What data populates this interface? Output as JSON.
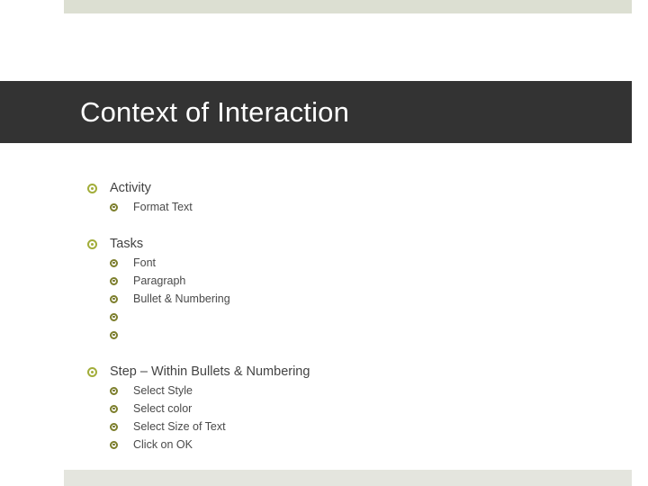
{
  "slide": {
    "title": "Context of Interaction",
    "colors": {
      "title_bar": "#333333",
      "title_text": "#ffffff",
      "band_top": "#dcdfd2",
      "band_bottom": "#e4e5de",
      "bullet_level1": "#a2ad3a",
      "bullet_level2": "#7d7f2c",
      "body_text": "#434343",
      "background": "#ffffff"
    },
    "bullet_icon": "bullseye-bullet-icon",
    "groups": [
      {
        "heading": "Activity",
        "items": [
          "Format Text"
        ]
      },
      {
        "heading": "Tasks",
        "items": [
          "Font",
          "Paragraph",
          "Bullet & Numbering",
          "",
          ""
        ]
      },
      {
        "heading": "Step – Within Bullets & Numbering",
        "items": [
          "Select Style",
          "Select color",
          "Select Size of Text",
          "Click on OK"
        ]
      }
    ]
  }
}
